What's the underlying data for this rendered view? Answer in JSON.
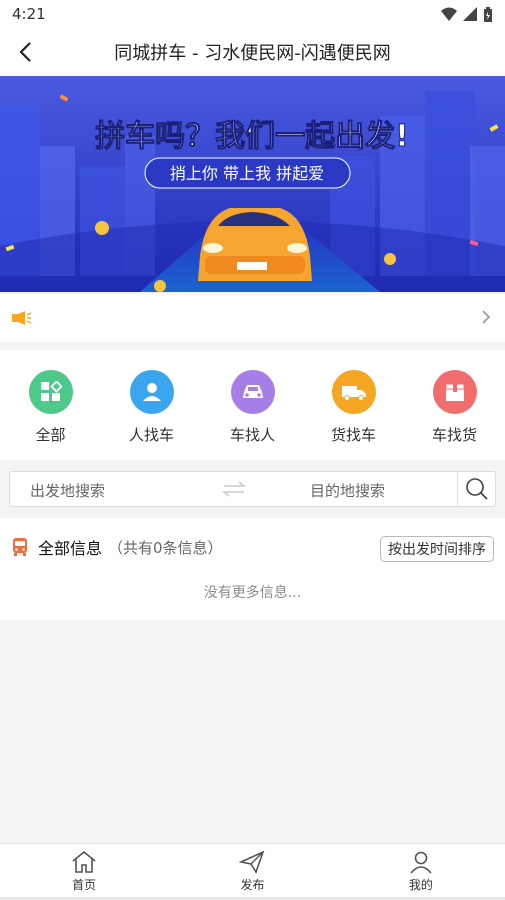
{
  "status": {
    "time": "4:21"
  },
  "header": {
    "title": "同城拼车 - 习水便民网-闪遇便民网"
  },
  "banner": {
    "headline": "拼车吗？我们一起出发!",
    "subline": "捎上你 带上我 拼起爱"
  },
  "categories": [
    {
      "label": "全部",
      "color": "#4dc98a",
      "icon": "grid-icon"
    },
    {
      "label": "人找车",
      "color": "#3ba6f0",
      "icon": "person-icon"
    },
    {
      "label": "车找人",
      "color": "#a77de8",
      "icon": "car-icon"
    },
    {
      "label": "货找车",
      "color": "#f5a623",
      "icon": "truck-icon"
    },
    {
      "label": "车找货",
      "color": "#f26d6d",
      "icon": "box-icon"
    }
  ],
  "search": {
    "from_placeholder": "出发地搜索",
    "to_placeholder": "目的地搜索"
  },
  "info": {
    "title": "全部信息",
    "count": "（共有0条信息）",
    "sort_label": "按出发时间排序",
    "empty_text": "没有更多信息..."
  },
  "bottom_nav": [
    {
      "label": "首页",
      "icon": "home-icon"
    },
    {
      "label": "发布",
      "icon": "send-icon"
    },
    {
      "label": "我的",
      "icon": "user-icon"
    }
  ],
  "colors": {
    "accent": "#f26d3d",
    "banner_bg": "#3b4fd8"
  }
}
